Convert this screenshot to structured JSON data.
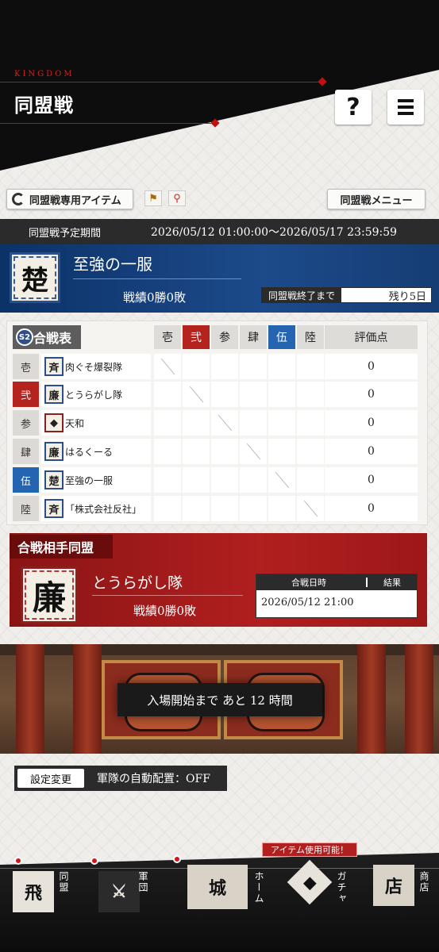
{
  "header": {
    "brand": "KINGDOM",
    "title": "同盟戦",
    "help_label": "?"
  },
  "toolbar": {
    "item_button": "同盟戦専用アイテム",
    "menu_button": "同盟戦メニュー",
    "flag_icon": "flag-icon",
    "pin_icon": "pin-icon"
  },
  "period": {
    "label": "同盟戦予定期間",
    "value": "2026/05/12 01:00:00～2026/05/17 23:59:59"
  },
  "alliance": {
    "emblem": "楚",
    "name": "至強の一服",
    "record": "戦績0勝0敗",
    "remain_label": "同盟戦終了まで",
    "remain_value": "残り5日"
  },
  "table": {
    "season": "S2",
    "title": "合戦表",
    "columns": [
      "壱",
      "弐",
      "参",
      "肆",
      "伍",
      "陸"
    ],
    "score_header": "評価点",
    "rows": [
      {
        "label": "壱",
        "emblem": "斉",
        "name": "肉ぐそ爆裂隊",
        "score": "0"
      },
      {
        "label": "弐",
        "emblem": "廉",
        "name": "とうらがし隊",
        "score": "0"
      },
      {
        "label": "参",
        "emblem": "◆",
        "name": "天和",
        "score": "0"
      },
      {
        "label": "肆",
        "emblem": "廉",
        "name": "はるくーる",
        "score": "0"
      },
      {
        "label": "伍",
        "emblem": "楚",
        "name": "至強の一服",
        "score": "0"
      },
      {
        "label": "陸",
        "emblem": "斉",
        "name": "「株式会社反社」",
        "score": "0"
      }
    ]
  },
  "opponent": {
    "tab": "合戦相手同盟",
    "emblem": "廉",
    "name": "とうらがし隊",
    "record": "戦績0勝0敗",
    "date_header": "合戦日時",
    "result_header": "結果",
    "date": "2026/05/12 21:00"
  },
  "gate": {
    "caption": "入場開始まで あと 12 時間"
  },
  "settings": {
    "button": "設定変更",
    "text": "軍隊の自動配置：OFF"
  },
  "nav": {
    "item_ready": "アイテム使用可能！",
    "items": [
      {
        "icon": "飛",
        "label": "同盟"
      },
      {
        "icon": "⚔",
        "label": "軍団"
      },
      {
        "icon": "城",
        "label": "ホーム"
      },
      {
        "icon": "◆",
        "label": "ガチャ"
      },
      {
        "icon": "店",
        "label": "商店"
      }
    ]
  },
  "colors": {
    "accent_red": "#b5231f",
    "accent_blue": "#2464b0",
    "header_bg": "#0d0d0d",
    "alliance_bg": "#0c3268",
    "opponent_bg": "#b11f1f"
  }
}
